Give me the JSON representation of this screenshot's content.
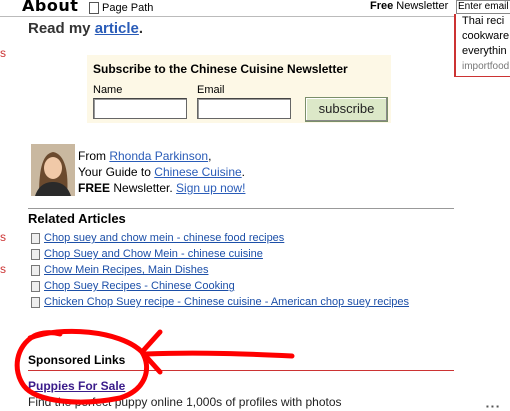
{
  "topbar": {
    "logo_text": "About",
    "page_path_label": "Page Path",
    "newsletter_bold": "Free",
    "newsletter_rest": " Newsletter",
    "email_placeholder": "Enter email"
  },
  "right_ad": {
    "lines": [
      "Thai reci",
      "cookware",
      "everythin"
    ],
    "source": "importfood"
  },
  "left_edge_letters": [
    "s",
    "s",
    "s"
  ],
  "intro": {
    "prefix": "Read my ",
    "link": "article",
    "suffix": "."
  },
  "subscribe": {
    "title": "Subscribe to the Chinese Cuisine Newsletter",
    "name_label": "Name",
    "email_label": "Email",
    "name_value": "",
    "email_value": "",
    "button_label": "subscribe"
  },
  "author": {
    "from_text": "From ",
    "name": "Rhonda Parkinson",
    "comma": ",",
    "guide_prefix": "Your Guide to ",
    "guide_link": "Chinese Cuisine",
    "guide_suffix": ".",
    "free_bold": "FREE",
    "newsletter_text": " Newsletter. ",
    "signup_link": "Sign up now!"
  },
  "related": {
    "title": "Related Articles",
    "items": [
      "Chop suey and chow mein - chinese food recipes",
      "Chop Suey and Chow Mein - chinese cuisine",
      "Chow Mein Recipes, Main Dishes",
      "Chop Suey Recipes - Chinese Cooking",
      "Chicken Chop Suey recipe - Chinese cuisine - American chop suey recipes"
    ]
  },
  "sponsored": {
    "title": "Sponsored Links",
    "link": "Puppies For Sale",
    "description": "Find the perfect puppy online 1,000s of profiles with photos"
  },
  "colors": {
    "annotation": "#ff0000",
    "link": "#1c4fa8",
    "visited_link": "#3a1b8a",
    "subscribe_bg": "#fdf8e6",
    "button_bg": "#dce8c8"
  }
}
